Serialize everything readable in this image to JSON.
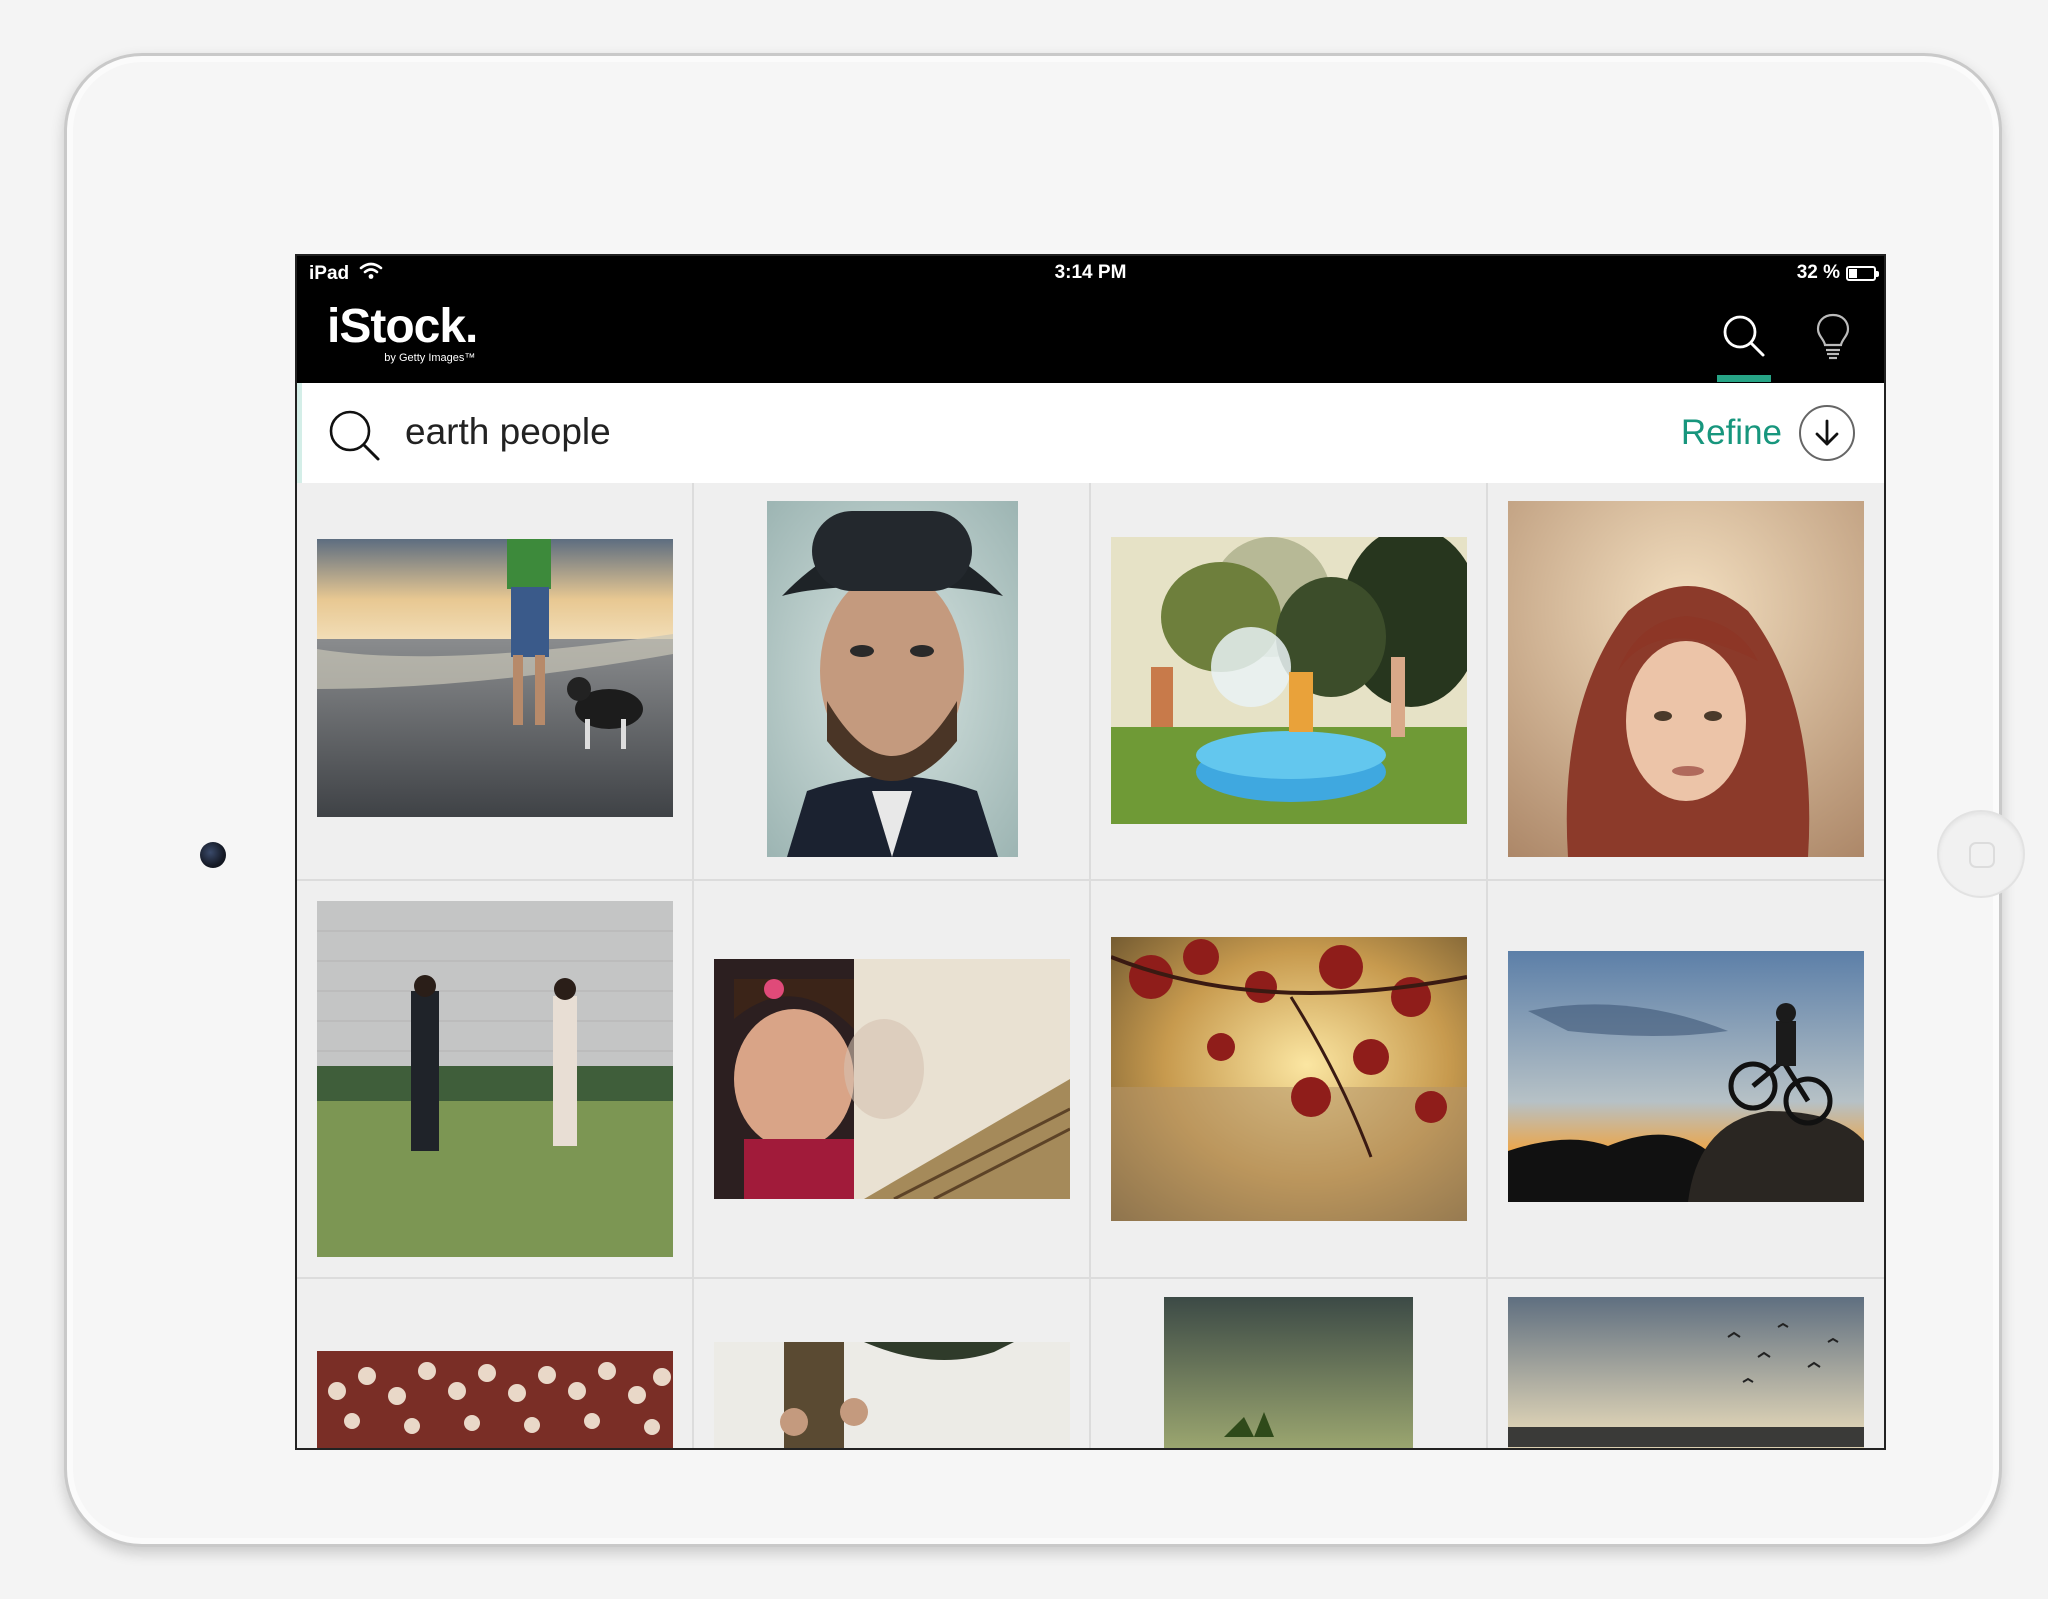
{
  "status_bar": {
    "device": "iPad",
    "time": "3:14 PM",
    "battery": "32 %",
    "battery_level": 0.32
  },
  "app": {
    "logo": "iStock.",
    "logo_sub": "by Getty Images™"
  },
  "search": {
    "query": "earth people",
    "refine_label": "Refine"
  },
  "icons": {
    "search": "search-icon",
    "ideas": "lightbulb-icon",
    "refine": "arrow-down-circle-icon"
  },
  "colors": {
    "accent": "#17967d",
    "tab_indicator": "#27a486"
  }
}
